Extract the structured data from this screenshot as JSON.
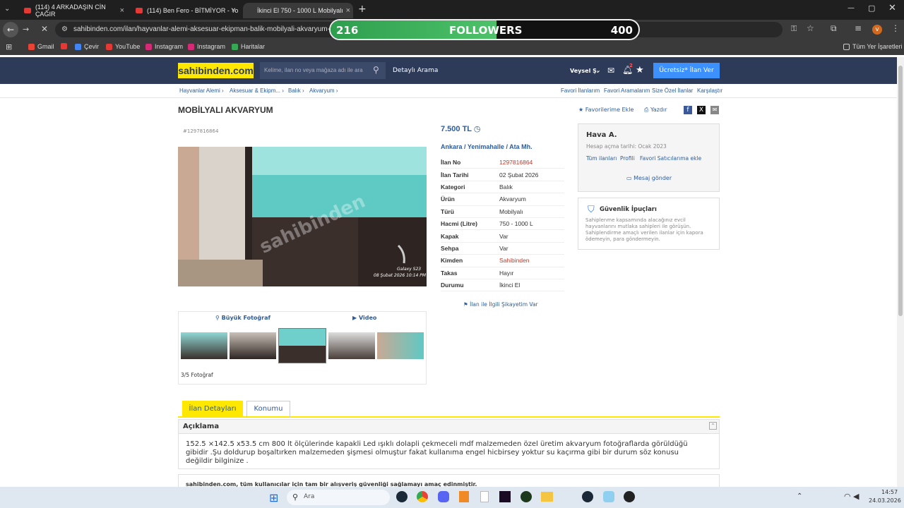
{
  "browser": {
    "tabs": [
      {
        "label": "(114) 4 ARKADAŞIN CİN ÇAĞIR",
        "close": "×"
      },
      {
        "label": "(114) Ben Fero - BİTMİYOR - Yo",
        "close": "×"
      },
      {
        "label": "İkinci El 750 - 1000 L Mobilyalı",
        "close": "×"
      }
    ],
    "new_tab": "+",
    "url": "sahibinden.com/ilan/hayvanlar-alemi-aksesuar-ekipman-balik-mobilyali-akvaryum-1297",
    "bookmarks": [
      "Gmail",
      "Çevir",
      "YouTube",
      "Instagram",
      "Instagram",
      "Haritalar"
    ],
    "all_bookmarks": "Tüm Yer İşaretleri",
    "profile_initial": "v"
  },
  "overlay": {
    "left": "216",
    "label": "FOLLOWERS",
    "right": "400",
    "progress": 0.54
  },
  "site": {
    "logo": "sahibinden.com",
    "search_placeholder": "Kelime, ilan no veya mağaza adı ile ara",
    "advanced_search": "Detaylı Arama",
    "user": "Veysel Ş.",
    "notif_count": "2",
    "post_button": "Ücretsiz* İlan Ver",
    "breadcrumbs": [
      "Hayvanlar Alemi ›",
      "Aksesuar & Ekipm... ›",
      "Balık ›",
      "Akvaryum ›"
    ],
    "right_links": [
      "Favori İlanlarım",
      "Favori Aramalarım",
      "Size Özel İlanlar",
      "Karşılaştır"
    ]
  },
  "listing": {
    "title": "MOBİLYALI AKVARYUM",
    "add_fav": "Favorilerime Ekle",
    "print": "Yazdır",
    "id_small": "#1297816864",
    "price": "7.500 TL",
    "location": [
      "Ankara",
      "/",
      "Yenimahalle",
      "/",
      "Ata Mh."
    ],
    "details": [
      {
        "k": "İlan No",
        "v": "1297816864",
        "red": true
      },
      {
        "k": "İlan Tarihi",
        "v": "02 Şubat 2026",
        "red": false
      },
      {
        "k": "Kategori",
        "v": "Balık",
        "red": false
      },
      {
        "k": "Ürün",
        "v": "Akvaryum",
        "red": false
      },
      {
        "k": "Türü",
        "v": "Mobilyalı",
        "red": false
      },
      {
        "k": "Hacmi (Litre)",
        "v": "750 - 1000 L",
        "red": false
      },
      {
        "k": "Kapak",
        "v": "Var",
        "red": false
      },
      {
        "k": "Sehpa",
        "v": "Var",
        "red": false
      },
      {
        "k": "Kimden",
        "v": "Sahibinden",
        "red": true
      },
      {
        "k": "Takas",
        "v": "Hayır",
        "red": false
      },
      {
        "k": "Durumu",
        "v": "İkinci El",
        "red": false
      }
    ],
    "complaint": "İlan ile İlgili Şikayetim Var",
    "photo_caption1": "Galaxy S23",
    "photo_caption2": "08 Şubat 2026 10:14 PM",
    "watermark": "sahibinden",
    "big_photo": "Büyük Fotoğraf",
    "video": "Video",
    "photo_count": "3/5 Fotoğraf"
  },
  "seller": {
    "name": "Hava A.",
    "since": "Hesap açma tarihi: Ocak 2023",
    "links": [
      "Tüm ilanları",
      "Profili",
      "Favori Satıcılarıma ekle"
    ],
    "message": "Mesaj gönder"
  },
  "safety": {
    "title": "Güvenlik İpuçları",
    "text": "Sahiplenme kapsamında alacağınız evcil hayvanlarını mutlaka sahipleri ile görüşün. Sahiplendirme amaçlı verilen ilanlar için kapora ödemeyin, para göndermeyin."
  },
  "tabs": {
    "details": "İlan Detayları",
    "location": "Konumu"
  },
  "description": {
    "heading": "Açıklama",
    "text": "152.5 ×142.5 x53.5 cm 800 lt ölçülerinde kapakli Led ışıklı dolapli çekmeceli mdf malzemeden özel üretim akvaryum fotoğraflarda görüldüğü gibidir .Şu doldurup boşaltırken malzemeden şişmesi olmuştur fakat kullanıma engel hicbirsey yoktur su kaçırma gibi bir durum söz konusu değildir bilginize .",
    "next_box": "sahibinden.com, tüm kullanıcılar için tam bir alışveriş güvenliği sağlamayı amaç edinmiştir."
  },
  "taskbar": {
    "search": "Ara",
    "time": "14:57",
    "date": "24.03.2026"
  }
}
